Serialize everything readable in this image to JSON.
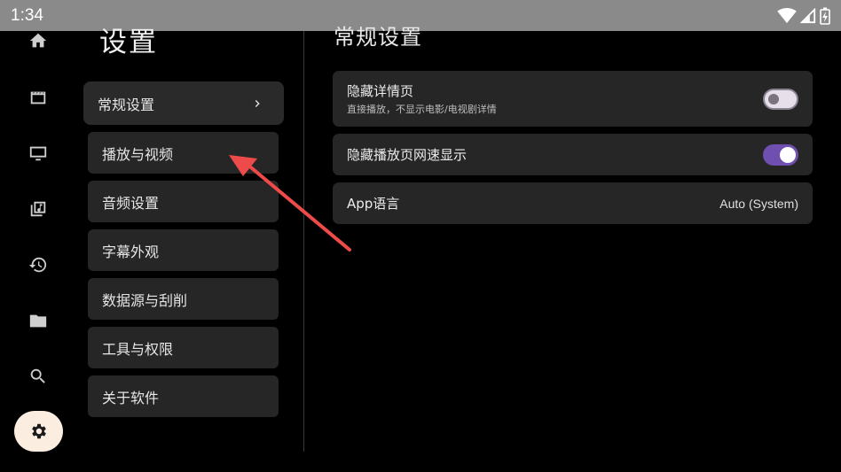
{
  "status_bar": {
    "time": "1:34",
    "icons": [
      "wifi-icon",
      "signal-icon",
      "battery-charging-icon"
    ]
  },
  "nav_rail": {
    "items": [
      {
        "icon": "home-icon",
        "active": false
      },
      {
        "icon": "movie-icon",
        "active": false
      },
      {
        "icon": "tv-icon",
        "active": false
      },
      {
        "icon": "music-library-icon",
        "active": false
      },
      {
        "icon": "history-icon",
        "active": false
      },
      {
        "icon": "folder-icon",
        "active": false
      },
      {
        "icon": "search-icon",
        "active": false
      },
      {
        "icon": "settings-gear-icon",
        "active": true
      }
    ]
  },
  "settings": {
    "title": "设置",
    "categories": [
      {
        "label": "常规设置",
        "selected": true
      },
      {
        "label": "播放与视频",
        "selected": false
      },
      {
        "label": "音频设置",
        "selected": false
      },
      {
        "label": "字幕外观",
        "selected": false
      },
      {
        "label": "数据源与刮削",
        "selected": false
      },
      {
        "label": "工具与权限",
        "selected": false
      },
      {
        "label": "关于软件",
        "selected": false
      }
    ]
  },
  "general": {
    "section_title": "常规设置",
    "hide_detail": {
      "label": "隐藏详情页",
      "sub": "直接播放，不显示电影/电视剧详情",
      "enabled": false
    },
    "hide_speed": {
      "label": "隐藏播放页网速显示",
      "enabled": true
    },
    "app_language": {
      "label": "App语言",
      "value": "Auto (System)"
    }
  },
  "colors": {
    "accent": "#6f4fb0",
    "active_nav_bg": "#fbeee0",
    "annotation_arrow": "#ef4a4a"
  }
}
